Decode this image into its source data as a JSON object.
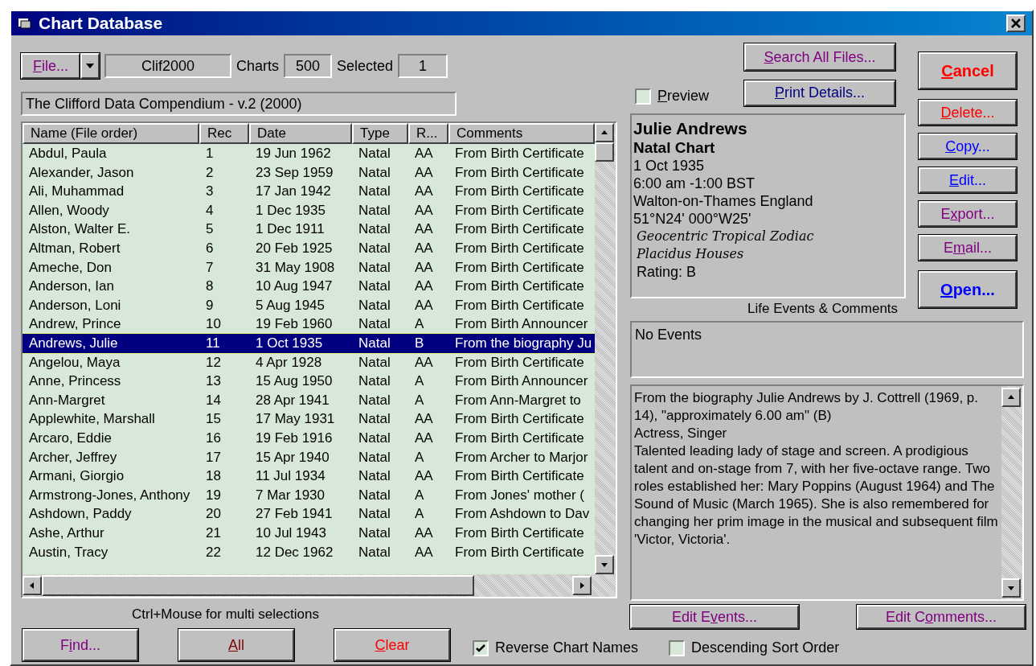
{
  "window": {
    "title": "Chart Database"
  },
  "file_button": {
    "label": [
      {
        "text": "F",
        "underline": true
      },
      {
        "text": "ile...",
        "underline": false
      }
    ],
    "color": "#800080"
  },
  "file_name": "Clif2000",
  "charts": {
    "label": "Charts",
    "value": "500"
  },
  "selected": {
    "label": "Selected",
    "value": "1"
  },
  "description": "The Clifford Data Compendium - v.2 (2000)",
  "table": {
    "columns": [
      "Name (File order)",
      "Rec",
      "Date",
      "Type",
      "R...",
      "Comments"
    ],
    "rows": [
      {
        "cells": [
          "Abdul, Paula",
          "1",
          "19 Jun 1962",
          "Natal",
          "AA",
          "From Birth Certificate"
        ],
        "selected": false
      },
      {
        "cells": [
          "Alexander, Jason",
          "2",
          "23 Sep 1959",
          "Natal",
          "AA",
          "From Birth Certificate"
        ],
        "selected": false
      },
      {
        "cells": [
          "Ali, Muhammad",
          "3",
          "17 Jan 1942",
          "Natal",
          "AA",
          "From Birth Certificate"
        ],
        "selected": false
      },
      {
        "cells": [
          "Allen, Woody",
          "4",
          "1 Dec 1935",
          "Natal",
          "AA",
          "From Birth Certificate"
        ],
        "selected": false
      },
      {
        "cells": [
          "Alston, Walter E.",
          "5",
          "1 Dec 1911",
          "Natal",
          "AA",
          "From Birth Certificate"
        ],
        "selected": false
      },
      {
        "cells": [
          "Altman, Robert",
          "6",
          "20 Feb 1925",
          "Natal",
          "AA",
          "From Birth Certificate"
        ],
        "selected": false
      },
      {
        "cells": [
          "Ameche, Don",
          "7",
          "31 May 1908",
          "Natal",
          "AA",
          "From Birth Certificate"
        ],
        "selected": false
      },
      {
        "cells": [
          "Anderson, Ian",
          "8",
          "10 Aug 1947",
          "Natal",
          "AA",
          "From Birth Certificate"
        ],
        "selected": false
      },
      {
        "cells": [
          "Anderson, Loni",
          "9",
          "5 Aug 1945",
          "Natal",
          "AA",
          "From Birth Certificate"
        ],
        "selected": false
      },
      {
        "cells": [
          "Andrew, Prince",
          "10",
          "19 Feb 1960",
          "Natal",
          "A",
          "From Birth Announcer"
        ],
        "selected": false
      },
      {
        "cells": [
          "Andrews, Julie",
          "11",
          "1 Oct 1935",
          "Natal",
          "B",
          "From the biography Ju"
        ],
        "selected": true
      },
      {
        "cells": [
          "Angelou, Maya",
          "12",
          "4 Apr 1928",
          "Natal",
          "AA",
          "From Birth Certificate"
        ],
        "selected": false
      },
      {
        "cells": [
          "Anne, Princess",
          "13",
          "15 Aug 1950",
          "Natal",
          "A",
          "From Birth Announcer"
        ],
        "selected": false
      },
      {
        "cells": [
          "Ann-Margret",
          "14",
          "28 Apr 1941",
          "Natal",
          "A",
          "From Ann-Margret to"
        ],
        "selected": false
      },
      {
        "cells": [
          "Applewhite, Marshall",
          "15",
          "17 May 1931",
          "Natal",
          "AA",
          "From Birth Certificate"
        ],
        "selected": false
      },
      {
        "cells": [
          "Arcaro, Eddie",
          "16",
          "19 Feb 1916",
          "Natal",
          "AA",
          "From Birth Certificate"
        ],
        "selected": false
      },
      {
        "cells": [
          "Archer, Jeffrey",
          "17",
          "15 Apr 1940",
          "Natal",
          "A",
          "From Archer to Marjor"
        ],
        "selected": false
      },
      {
        "cells": [
          "Armani, Giorgio",
          "18",
          "11 Jul 1934",
          "Natal",
          "AA",
          "From Birth Certificate"
        ],
        "selected": false
      },
      {
        "cells": [
          "Armstrong-Jones, Anthony",
          "19",
          "7 Mar 1930",
          "Natal",
          "A",
          "From Jones' mother ("
        ],
        "selected": false
      },
      {
        "cells": [
          "Ashdown, Paddy",
          "20",
          "27 Feb 1941",
          "Natal",
          "A",
          "From Ashdown to Dav"
        ],
        "selected": false
      },
      {
        "cells": [
          "Ashe, Arthur",
          "21",
          "10 Jul 1943",
          "Natal",
          "AA",
          "From Birth Certificate"
        ],
        "selected": false
      },
      {
        "cells": [
          "Austin, Tracy",
          "22",
          "12 Dec 1962",
          "Natal",
          "AA",
          "From Birth Certificate"
        ],
        "selected": false
      }
    ]
  },
  "hint": "Ctrl+Mouse for multi selections",
  "top_buttons": [
    {
      "label": [
        {
          "text": "S",
          "underline": true
        },
        {
          "text": "earch All Files...",
          "underline": false
        }
      ],
      "color": "#800080"
    },
    {
      "label": [
        {
          "text": "P",
          "underline": true
        },
        {
          "text": "rint Details...",
          "underline": false
        }
      ],
      "color": "#000080"
    }
  ],
  "preview": {
    "label": [
      {
        "text": "P",
        "underline": true
      },
      {
        "text": "review",
        "underline": false
      }
    ],
    "checked": false
  },
  "details": [
    {
      "kind": "title",
      "text": "Julie Andrews"
    },
    {
      "kind": "bold",
      "text": "Natal Chart"
    },
    {
      "kind": "plain",
      "text": "1 Oct 1935"
    },
    {
      "kind": "plain",
      "text": "6:00 am  -1:00 BST"
    },
    {
      "kind": "plain",
      "text": "Walton-on-Thames England"
    },
    {
      "kind": "plain",
      "text": "51°N24' 000°W25'"
    },
    {
      "kind": "italic",
      "text": "Geocentric Tropical Zodiac"
    },
    {
      "kind": "italic",
      "text": "Placidus Houses"
    },
    {
      "kind": "indented",
      "text": "Rating: B"
    }
  ],
  "side_buttons": [
    {
      "label": [
        {
          "text": "C",
          "underline": true
        },
        {
          "text": "ancel",
          "underline": false
        }
      ],
      "color": "#ff0000",
      "bold": true
    },
    {
      "label": [
        {
          "text": "D",
          "underline": true
        },
        {
          "text": "elete...",
          "underline": false
        }
      ],
      "color": "#ff0000",
      "bold": false
    },
    {
      "label": [
        {
          "text": "C",
          "underline": true
        },
        {
          "text": "opy...",
          "underline": false
        }
      ],
      "color": "#0000ff",
      "bold": false
    },
    {
      "label": [
        {
          "text": "E",
          "underline": true
        },
        {
          "text": "dit...",
          "underline": false
        }
      ],
      "color": "#0000ff",
      "bold": false
    },
    {
      "label": [
        {
          "text": "E",
          "underline": false
        },
        {
          "text": "x",
          "underline": true
        },
        {
          "text": "port...",
          "underline": false
        }
      ],
      "color": "#800080",
      "bold": false
    },
    {
      "label": [
        {
          "text": "E",
          "underline": false
        },
        {
          "text": "m",
          "underline": true
        },
        {
          "text": "ail...",
          "underline": false
        }
      ],
      "color": "#800080",
      "bold": false
    },
    {
      "label": [
        {
          "text": "O",
          "underline": true
        },
        {
          "text": "pen...",
          "underline": false
        }
      ],
      "color": "#0000ff",
      "bold": true
    }
  ],
  "events_label": "Life Events & Comments",
  "events": "No Events",
  "comments": [
    "From the biography Julie Andrews by J. Cottrell (1969, p. 14), \"approximately 6.00 am\" (B)",
    "Actress, Singer",
    "Talented leading lady of stage and screen.  A prodigious talent and on-stage from 7, with her five-octave range.  Two roles established her: Mary Poppins (August 1964) and The Sound of Music (March 1965).  She is also remembered for changing her prim image in the musical and subsequent film 'Victor, Victoria'."
  ],
  "edit_buttons": [
    {
      "label": [
        {
          "text": "Edit E",
          "underline": false
        },
        {
          "text": "v",
          "underline": true
        },
        {
          "text": "ents...",
          "underline": false
        }
      ],
      "color": "#800080"
    },
    {
      "label": [
        {
          "text": "Edit C",
          "underline": false
        },
        {
          "text": "o",
          "underline": true
        },
        {
          "text": "mments...",
          "underline": false
        }
      ],
      "color": "#800080"
    }
  ],
  "bottom_buttons": [
    {
      "label": [
        {
          "text": "F",
          "underline": false
        },
        {
          "text": "i",
          "underline": true
        },
        {
          "text": "nd...",
          "underline": false
        }
      ],
      "color": "#800080"
    },
    {
      "label": [
        {
          "text": "A",
          "underline": true
        },
        {
          "text": "ll",
          "underline": false
        }
      ],
      "color": "#800000"
    },
    {
      "label": [
        {
          "text": "C",
          "underline": true
        },
        {
          "text": "lear",
          "underline": false
        }
      ],
      "color": "#ff0000"
    }
  ],
  "options": [
    {
      "label": [
        {
          "text": "Reverse Chart Names",
          "underline": false
        }
      ],
      "checked": true
    },
    {
      "label": [
        {
          "text": "Descending Sort Order",
          "underline": false
        }
      ],
      "checked": false
    }
  ]
}
